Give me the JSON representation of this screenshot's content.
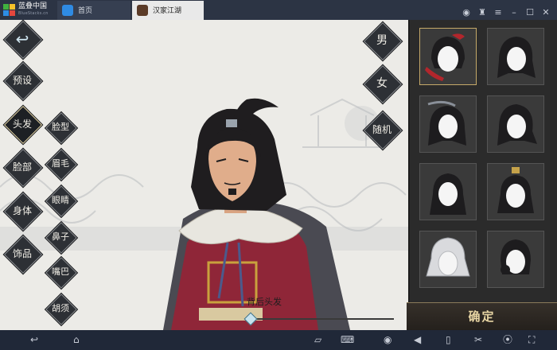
{
  "titlebar": {
    "app_name": "蓝叠中国",
    "app_sub": "BlueStacks.cn",
    "tabs": [
      {
        "label": "首页"
      },
      {
        "label": "汉家江湖"
      }
    ]
  },
  "left_menu": {
    "back_icon": "back-arrow-icon",
    "preset": "预设",
    "categories": [
      {
        "label": "头发"
      },
      {
        "label": "脸部"
      },
      {
        "label": "身体"
      },
      {
        "label": "饰品"
      }
    ],
    "sub_items": [
      {
        "label": "脸型"
      },
      {
        "label": "眉毛"
      },
      {
        "label": "眼睛"
      },
      {
        "label": "鼻子"
      },
      {
        "label": "嘴巴"
      },
      {
        "label": "胡须"
      }
    ]
  },
  "right_menu": {
    "male": "男",
    "female": "女",
    "random": "随机"
  },
  "slider": {
    "label": "背后头发"
  },
  "hair_panel": {
    "confirm": "确定"
  },
  "colors": {
    "accent_gold": "#c5a969",
    "titlebar": "#2c3444",
    "robe": "#8f2638"
  }
}
